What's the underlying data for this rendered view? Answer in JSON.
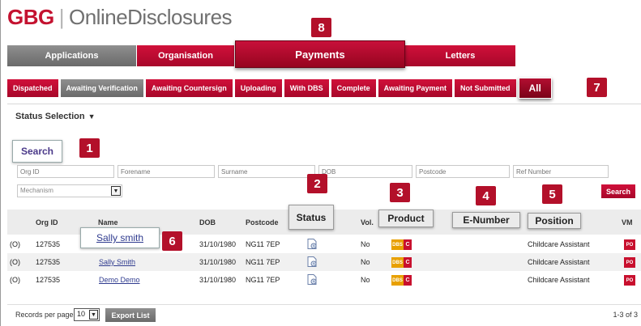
{
  "logo": {
    "brand": "GBG",
    "separator": "|",
    "product": "OnlineDisclosures"
  },
  "main_nav": {
    "tabs": [
      {
        "label": "Applications"
      },
      {
        "label": "Organisation"
      },
      {
        "label": "Payments"
      },
      {
        "label": "Letters"
      }
    ]
  },
  "status_tabs": [
    {
      "label": "Dispatched"
    },
    {
      "label": "Awaiting Verification"
    },
    {
      "label": "Awaiting Countersign"
    },
    {
      "label": "Uploading"
    },
    {
      "label": "With DBS"
    },
    {
      "label": "Complete"
    },
    {
      "label": "Awaiting Payment"
    },
    {
      "label": "Not Submitted"
    },
    {
      "label": "All"
    }
  ],
  "status_selection": {
    "label": "Status Selection",
    "caret": "▼"
  },
  "search": {
    "label": "Search",
    "placeholders": {
      "org_id": "Org ID",
      "forename": "Forename",
      "surname": "Surname",
      "dob": "DOB",
      "postcode": "Postcode",
      "ref_number": "Ref Number"
    },
    "mechanism_placeholder": "Mechanism",
    "button": "Search"
  },
  "table": {
    "headers": {
      "org_id": "Org ID",
      "name": "Name",
      "dob": "DOB",
      "postcode": "Postcode",
      "status": "Status",
      "vol": "Vol.",
      "product": "Product",
      "e_number": "E-Number",
      "position": "Position",
      "vm": "VM"
    },
    "rows": [
      {
        "prefix": "(O)",
        "org_id": "127535",
        "name": "Sally smith",
        "dob": "31/10/1980",
        "postcode": "NG11 7EP",
        "vol": "No",
        "product_dbs": "DBS",
        "product_c": "C",
        "position": "Childcare Assistant",
        "vm": "PO"
      },
      {
        "prefix": "(O)",
        "org_id": "127535",
        "name": "Sally Smith",
        "dob": "31/10/1980",
        "postcode": "NG11 7EP",
        "vol": "No",
        "product_dbs": "DBS",
        "product_c": "C",
        "position": "Childcare Assistant",
        "vm": "PO"
      },
      {
        "prefix": "(O)",
        "org_id": "127535",
        "name": "Demo Demo",
        "dob": "31/10/1980",
        "postcode": "NG11 7EP",
        "vol": "No",
        "product_dbs": "DBS",
        "product_c": "C",
        "position": "Childcare Assistant",
        "vm": "PO"
      }
    ]
  },
  "footer": {
    "records_per_page_label": "Records per page",
    "records_per_page_value": "10",
    "export_button": "Export List",
    "pager": "1-3 of 3"
  },
  "callouts": [
    "1",
    "2",
    "3",
    "4",
    "5",
    "6",
    "7",
    "8"
  ],
  "icons": {
    "status_document": "document-status-icon",
    "dropdown": "chevron-down-icon"
  },
  "colors": {
    "brand_red": "#c41230",
    "nav_grey": "#7a7a7a",
    "callout_red": "#b3102a",
    "dbs_orange": "#e8a000",
    "link_blue": "#2f3b8f"
  }
}
